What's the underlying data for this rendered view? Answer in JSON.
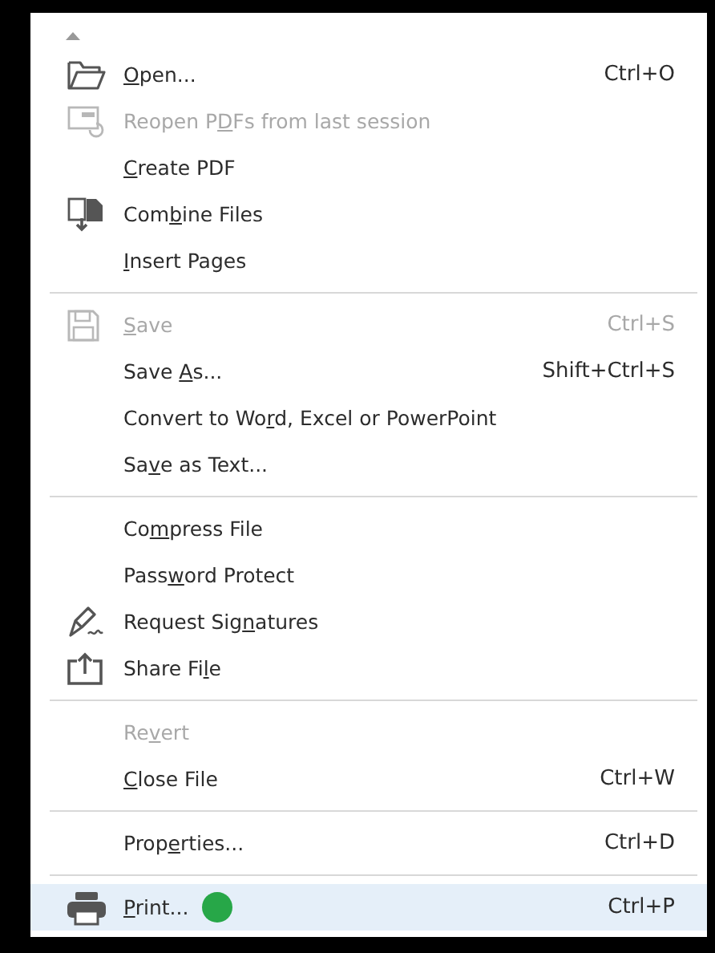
{
  "menu": {
    "groups": [
      {
        "items": [
          {
            "kind": "folder",
            "label": {
              "key": "O",
              "post": "pen..."
            },
            "shortcut": "Ctrl+O",
            "disabled": false,
            "selected": false
          },
          {
            "kind": "reopen",
            "label": {
              "pre": "Reopen P",
              "key": "D",
              "post": "Fs from last session"
            },
            "disabled": true,
            "selected": false
          },
          {
            "kind": "plain",
            "label": {
              "key": "C",
              "post": "reate PDF"
            },
            "disabled": false,
            "selected": false
          },
          {
            "kind": "combine",
            "label": {
              "pre": "Com",
              "key": "b",
              "post": "ine Files"
            },
            "disabled": false,
            "selected": false
          },
          {
            "kind": "plain",
            "label": {
              "key": "I",
              "post": "nsert Pages"
            },
            "disabled": false,
            "selected": false
          }
        ]
      },
      {
        "items": [
          {
            "kind": "save",
            "label": {
              "key": "S",
              "post": "ave"
            },
            "shortcut": "Ctrl+S",
            "disabled": true,
            "selected": false
          },
          {
            "kind": "plain",
            "label": {
              "pre": "Save ",
              "key": "A",
              "post": "s..."
            },
            "shortcut": "Shift+Ctrl+S",
            "disabled": false,
            "selected": false
          },
          {
            "kind": "plain",
            "label": {
              "pre": "Convert to Wo",
              "key": "r",
              "post": "d, Excel or PowerPoint"
            },
            "disabled": false,
            "selected": false
          },
          {
            "kind": "plain",
            "label": {
              "pre": "Sa",
              "key": "v",
              "post": "e as Text..."
            },
            "disabled": false,
            "selected": false
          }
        ]
      },
      {
        "items": [
          {
            "kind": "plain",
            "label": {
              "pre": "Co",
              "key": "m",
              "post": "press File"
            },
            "disabled": false,
            "selected": false
          },
          {
            "kind": "plain",
            "label": {
              "pre": "Pass",
              "key": "w",
              "post": "ord Protect"
            },
            "disabled": false,
            "selected": false
          },
          {
            "kind": "signature",
            "label": {
              "pre": "Request Sig",
              "key": "n",
              "post": "atures"
            },
            "disabled": false,
            "selected": false
          },
          {
            "kind": "share",
            "label": {
              "pre": "Share Fi",
              "key": "l",
              "post": "e"
            },
            "disabled": false,
            "selected": false
          }
        ]
      },
      {
        "items": [
          {
            "kind": "plain",
            "label": {
              "pre": "Re",
              "key": "v",
              "post": "ert"
            },
            "disabled": true,
            "selected": false
          },
          {
            "kind": "plain",
            "label": {
              "key": "C",
              "post": "lose File"
            },
            "shortcut": "Ctrl+W",
            "disabled": false,
            "selected": false
          }
        ]
      },
      {
        "items": [
          {
            "kind": "plain",
            "label": {
              "pre": "Prop",
              "key": "e",
              "post": "rties..."
            },
            "shortcut": "Ctrl+D",
            "disabled": false,
            "selected": false
          }
        ]
      },
      {
        "items": [
          {
            "kind": "printer",
            "label": {
              "key": "P",
              "post": "rint..."
            },
            "shortcut": "Ctrl+P",
            "disabled": false,
            "selected": true,
            "color": "#27a748"
          }
        ]
      }
    ]
  }
}
